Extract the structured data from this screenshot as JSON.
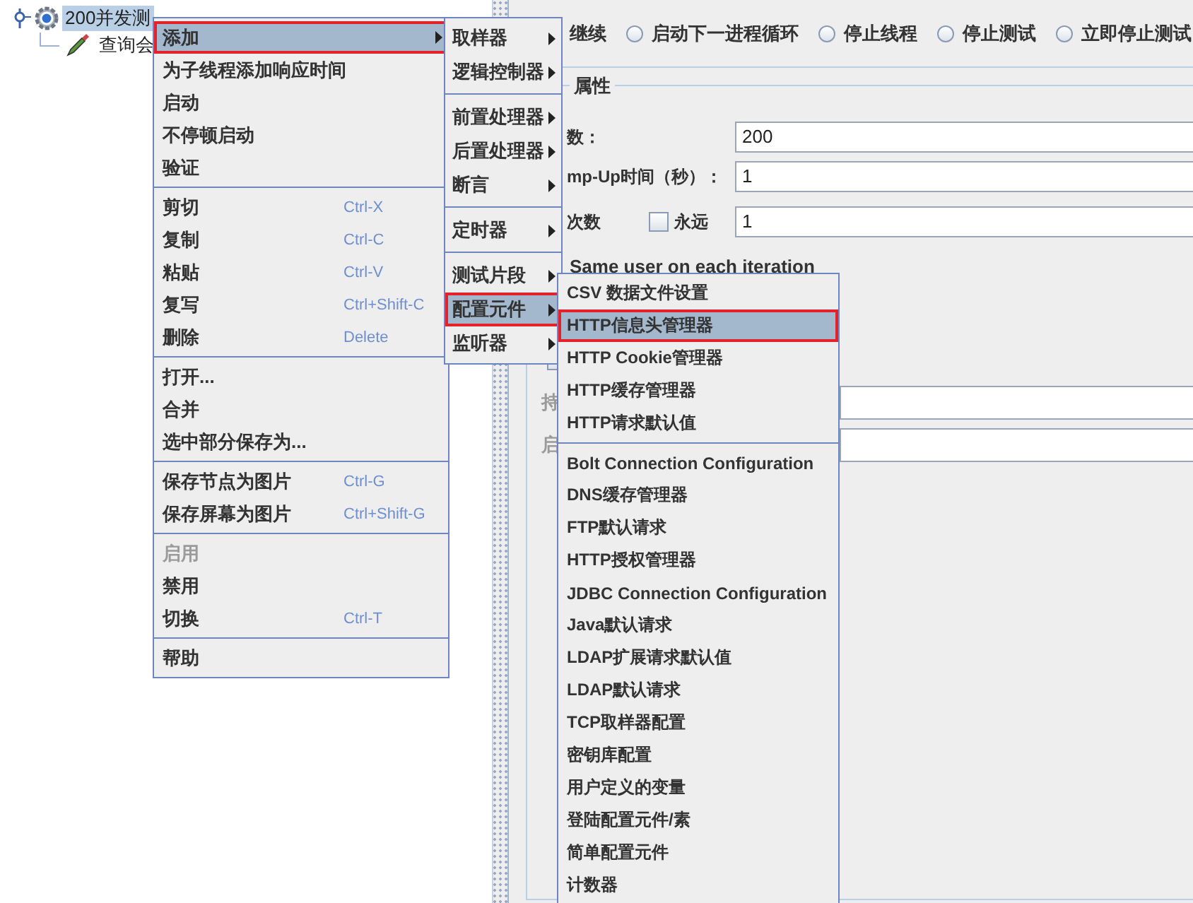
{
  "tree": {
    "items": [
      {
        "label": "200并发测",
        "selected": true,
        "children": [
          {
            "label": "查询会",
            "selected": false
          }
        ]
      }
    ]
  },
  "thread_group": {
    "error_action": {
      "first_label": "继续",
      "options": [
        {
          "label": "启动下一进程循环",
          "selected": false
        },
        {
          "label": "停止线程",
          "selected": false
        },
        {
          "label": "停止测试",
          "selected": false
        },
        {
          "label": "立即停止测试",
          "selected": false
        }
      ]
    },
    "properties": {
      "title": "属性",
      "fields": [
        {
          "label": "数：",
          "value": "200"
        },
        {
          "label": "mp-Up时间（秒）：",
          "value": "1"
        },
        {
          "label": "次数",
          "forever": {
            "label": "永远",
            "checked": false
          },
          "value": "1"
        }
      ],
      "same_user_label": "Same user on each iteration",
      "partial_checkbox": {
        "checked": false
      },
      "lower_rows": [
        {
          "label": "持",
          "disabled": true
        },
        {
          "label": "启",
          "disabled": true
        }
      ]
    }
  },
  "context_menu": {
    "groups": [
      {
        "items": [
          {
            "label": "添加",
            "submenu": true,
            "selected": true,
            "disabled": false,
            "annotated": true
          },
          {
            "label": "为子线程添加响应时间",
            "submenu": false,
            "selected": false,
            "disabled": false,
            "annotated": false
          },
          {
            "label": "启动",
            "submenu": false,
            "selected": false,
            "disabled": false,
            "annotated": false
          },
          {
            "label": "不停顿启动",
            "submenu": false,
            "selected": false,
            "disabled": false,
            "annotated": false
          },
          {
            "label": "验证",
            "submenu": false,
            "selected": false,
            "disabled": false,
            "annotated": false
          }
        ]
      },
      {
        "items": [
          {
            "label": "剪切",
            "submenu": false,
            "shortcut": "Ctrl-X",
            "selected": false,
            "disabled": false,
            "annotated": false
          },
          {
            "label": "复制",
            "submenu": false,
            "shortcut": "Ctrl-C",
            "selected": false,
            "disabled": false,
            "annotated": false
          },
          {
            "label": "粘贴",
            "submenu": false,
            "shortcut": "Ctrl-V",
            "selected": false,
            "disabled": false,
            "annotated": false
          },
          {
            "label": "复写",
            "submenu": false,
            "shortcut": "Ctrl+Shift-C",
            "selected": false,
            "disabled": false,
            "annotated": false
          },
          {
            "label": "删除",
            "submenu": false,
            "shortcut": "Delete",
            "selected": false,
            "disabled": false,
            "annotated": false
          }
        ]
      },
      {
        "items": [
          {
            "label": "打开...",
            "submenu": false,
            "selected": false,
            "disabled": false,
            "annotated": false
          },
          {
            "label": "合并",
            "submenu": false,
            "selected": false,
            "disabled": false,
            "annotated": false
          },
          {
            "label": "选中部分保存为...",
            "submenu": false,
            "selected": false,
            "disabled": false,
            "annotated": false
          }
        ]
      },
      {
        "items": [
          {
            "label": "保存节点为图片",
            "submenu": false,
            "shortcut": "Ctrl-G",
            "selected": false,
            "disabled": false,
            "annotated": false
          },
          {
            "label": "保存屏幕为图片",
            "submenu": false,
            "shortcut": "Ctrl+Shift-G",
            "selected": false,
            "disabled": false,
            "annotated": false
          }
        ]
      },
      {
        "items": [
          {
            "label": "启用",
            "submenu": false,
            "selected": false,
            "disabled": true,
            "annotated": false
          },
          {
            "label": "禁用",
            "submenu": false,
            "selected": false,
            "disabled": false,
            "annotated": false
          },
          {
            "label": "切换",
            "submenu": false,
            "shortcut": "Ctrl-T",
            "selected": false,
            "disabled": false,
            "annotated": false
          }
        ]
      },
      {
        "items": [
          {
            "label": "帮助",
            "submenu": false,
            "selected": false,
            "disabled": false,
            "annotated": false
          }
        ]
      }
    ]
  },
  "add_submenu": {
    "groups": [
      {
        "items": [
          {
            "label": "取样器",
            "submenu": true,
            "selected": false,
            "annotated": false
          },
          {
            "label": "逻辑控制器",
            "submenu": true,
            "selected": false,
            "annotated": false
          }
        ]
      },
      {
        "items": [
          {
            "label": "前置处理器",
            "submenu": true,
            "selected": false,
            "annotated": false
          },
          {
            "label": "后置处理器",
            "submenu": true,
            "selected": false,
            "annotated": false
          },
          {
            "label": "断言",
            "submenu": true,
            "selected": false,
            "annotated": false
          }
        ]
      },
      {
        "items": [
          {
            "label": "定时器",
            "submenu": true,
            "selected": false,
            "annotated": false
          }
        ]
      },
      {
        "items": [
          {
            "label": "测试片段",
            "submenu": true,
            "selected": false,
            "annotated": false
          },
          {
            "label": "配置元件",
            "submenu": true,
            "selected": true,
            "annotated": true
          },
          {
            "label": "监听器",
            "submenu": true,
            "selected": false,
            "annotated": false
          }
        ]
      }
    ]
  },
  "config_submenu": {
    "groups": [
      {
        "items": [
          {
            "label": "CSV 数据文件设置",
            "selected": false,
            "annotated": false
          },
          {
            "label": "HTTP信息头管理器",
            "selected": true,
            "annotated": true
          },
          {
            "label": "HTTP Cookie管理器",
            "selected": false,
            "annotated": false
          },
          {
            "label": "HTTP缓存管理器",
            "selected": false,
            "annotated": false
          },
          {
            "label": "HTTP请求默认值",
            "selected": false,
            "annotated": false
          }
        ]
      },
      {
        "items": [
          {
            "label": "Bolt Connection Configuration",
            "selected": false,
            "annotated": false
          },
          {
            "label": "DNS缓存管理器",
            "selected": false,
            "annotated": false
          },
          {
            "label": "FTP默认请求",
            "selected": false,
            "annotated": false
          },
          {
            "label": "HTTP授权管理器",
            "selected": false,
            "annotated": false
          },
          {
            "label": "JDBC Connection Configuration",
            "selected": false,
            "annotated": false
          },
          {
            "label": "Java默认请求",
            "selected": false,
            "annotated": false
          },
          {
            "label": "LDAP扩展请求默认值",
            "selected": false,
            "annotated": false
          },
          {
            "label": "LDAP默认请求",
            "selected": false,
            "annotated": false
          },
          {
            "label": "TCP取样器配置",
            "selected": false,
            "annotated": false
          },
          {
            "label": "密钥库配置",
            "selected": false,
            "annotated": false
          },
          {
            "label": "用户定义的变量",
            "selected": false,
            "annotated": false
          },
          {
            "label": "登陆配置元件/素",
            "selected": false,
            "annotated": false
          },
          {
            "label": "简单配置元件",
            "selected": false,
            "annotated": false
          },
          {
            "label": "计数器",
            "selected": false,
            "annotated": false
          }
        ]
      }
    ]
  }
}
